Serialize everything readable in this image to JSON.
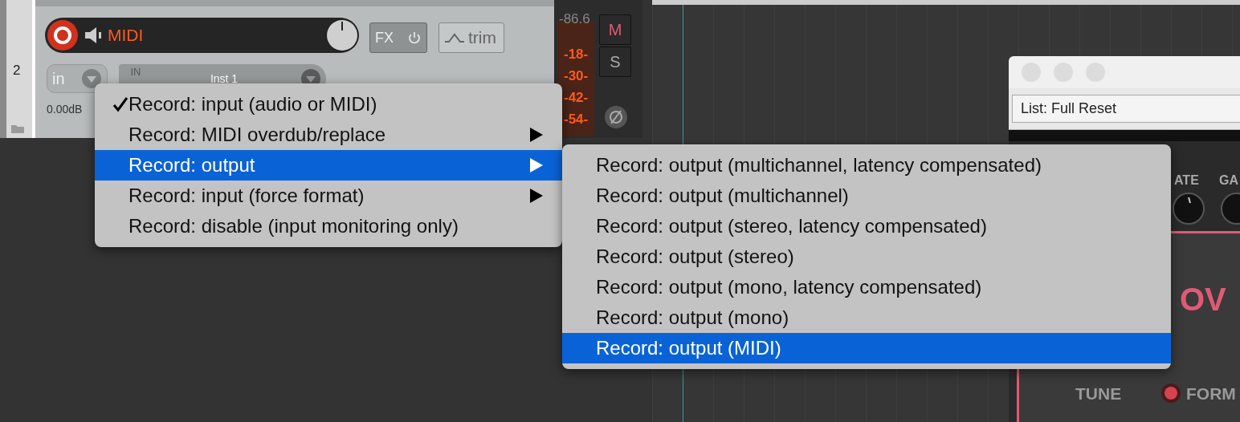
{
  "track": {
    "number": "2",
    "name": "MIDI",
    "armed": true,
    "fx_label": "FX",
    "trim_label": "trim",
    "input_label": "in",
    "input_tag": [
      "IN"
    ],
    "input_name": "Inst 1",
    "volume": "0.00dB"
  },
  "meter": {
    "peak": "-86.6",
    "scale": [
      "-18-",
      "-30-",
      "-42-",
      "-54-"
    ],
    "mute": "M",
    "solo": "S"
  },
  "plugin_window": {
    "preset": "List: Full Reset",
    "labels": [
      "ATE",
      "GA"
    ],
    "title": "OV",
    "tune": "TUNE",
    "formant": "FORM"
  },
  "menus": [
    {
      "items": [
        {
          "label": "Record: input (audio or MIDI)",
          "checked": true,
          "submenu": false,
          "selected": false
        },
        {
          "label": "Record: MIDI overdub/replace",
          "checked": false,
          "submenu": true,
          "selected": false
        },
        {
          "label": "Record: output",
          "checked": false,
          "submenu": true,
          "selected": true
        },
        {
          "label": "Record: input (force format)",
          "checked": false,
          "submenu": true,
          "selected": false
        },
        {
          "label": "Record: disable (input monitoring only)",
          "checked": false,
          "submenu": false,
          "selected": false
        }
      ]
    },
    {
      "items": [
        {
          "label": "Record: output (multichannel, latency compensated)",
          "selected": false
        },
        {
          "label": "Record: output (multichannel)",
          "selected": false
        },
        {
          "label": "Record: output (stereo, latency compensated)",
          "selected": false
        },
        {
          "label": "Record: output (stereo)",
          "selected": false
        },
        {
          "label": "Record: output (mono, latency compensated)",
          "selected": false
        },
        {
          "label": "Record: output (mono)",
          "selected": false
        },
        {
          "label": "Record: output (MIDI)",
          "selected": true
        }
      ]
    }
  ]
}
